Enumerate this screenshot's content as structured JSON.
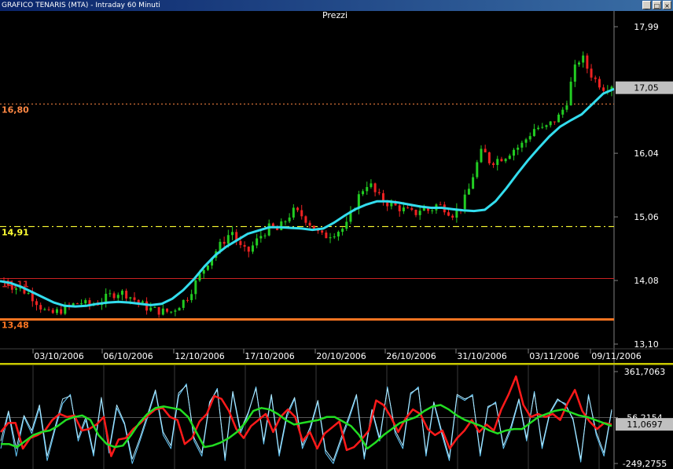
{
  "window": {
    "title": "GRAFICO TENARIS (MTA) - Intraday 60 Minuti",
    "buttons": [
      "_",
      "□",
      "×"
    ]
  },
  "colors": {
    "background": "#000000",
    "up_candle": "#22cc22",
    "down_candle": "#ee2222",
    "ma": "#33ddee",
    "resistance": "#ff8844",
    "dash_yellow": "#ffff33",
    "support_red": "#cc2222",
    "support_orange": "#ff7722",
    "separator": "#c8c800",
    "osc_red": "#ff1a1a",
    "osc_green": "#22dd22",
    "osc_blue": "#66ccff"
  },
  "chart_data": [
    {
      "type": "candlestick",
      "title": "Prezzi",
      "ylim": [
        13.1,
        17.99
      ],
      "y_ticks": [
        "17,99",
        "16,04",
        "15,06",
        "14,08",
        "13,10"
      ],
      "last_price_label": "17,05",
      "last_price": 17.05,
      "x_labels": [
        "03/10/2006",
        "06/10/2006",
        "12/10/2006",
        "17/10/2006",
        "20/10/2006",
        "26/10/2006",
        "31/10/2006",
        "03/11/2006",
        "09/11/2006"
      ],
      "levels": [
        {
          "label": "16,80",
          "value": 16.8,
          "style": "dotted",
          "color": "#ff8844"
        },
        {
          "label": "14,91",
          "value": 14.91,
          "style": "dashdot",
          "color": "#ffff33"
        },
        {
          "label": "14,11",
          "value": 14.11,
          "style": "solid",
          "color": "#cc2222"
        },
        {
          "label": "13,48",
          "value": 13.48,
          "style": "thick",
          "color": "#ff7722"
        }
      ],
      "close_path": [
        14.08,
        14.0,
        13.95,
        13.9,
        13.8,
        13.65,
        13.55,
        13.6,
        13.65,
        13.7,
        13.75,
        13.7,
        13.72,
        13.78,
        13.85,
        13.9,
        13.88,
        13.8,
        13.72,
        13.65,
        13.62,
        13.6,
        13.6,
        13.7,
        13.8,
        14.0,
        14.2,
        14.4,
        14.55,
        14.7,
        14.85,
        14.6,
        14.5,
        14.65,
        14.8,
        14.9,
        14.85,
        15.0,
        15.15,
        15.1,
        15.0,
        14.85,
        14.75,
        14.8,
        14.85,
        14.9,
        15.2,
        15.45,
        15.6,
        15.4,
        15.3,
        15.25,
        15.2,
        15.15,
        15.1,
        15.2,
        15.15,
        15.25,
        15.2,
        15.1,
        15.2,
        15.4,
        15.8,
        16.1,
        15.9,
        15.95,
        16.0,
        16.1,
        16.15,
        16.3,
        16.45,
        16.4,
        16.5,
        16.6,
        16.8,
        17.3,
        17.55,
        17.3,
        17.15,
        17.05,
        17.1
      ],
      "ma_path": [
        14.07,
        14.04,
        13.98,
        13.9,
        13.82,
        13.74,
        13.69,
        13.68,
        13.69,
        13.72,
        13.74,
        13.75,
        13.74,
        13.72,
        13.7,
        13.72,
        13.8,
        13.93,
        14.1,
        14.3,
        14.47,
        14.6,
        14.7,
        14.8,
        14.85,
        14.9,
        14.9,
        14.89,
        14.88,
        14.86,
        14.88,
        14.97,
        15.08,
        15.18,
        15.25,
        15.3,
        15.3,
        15.28,
        15.25,
        15.22,
        15.2,
        15.2,
        15.18,
        15.16,
        15.15,
        15.17,
        15.3,
        15.5,
        15.72,
        15.93,
        16.12,
        16.3,
        16.45,
        16.55,
        16.64,
        16.8,
        16.96,
        17.03
      ]
    },
    {
      "type": "line",
      "ylim": [
        -249.2755,
        361.7063
      ],
      "y_ticks": [
        "361,7063",
        "56,2154",
        "-249,2755"
      ],
      "current_value_label": "11,0697",
      "current_value": 11.0697,
      "series": [
        {
          "values": [
            -150,
            90,
            -200,
            60,
            -50,
            120,
            -230,
            -30,
            150,
            210,
            -100,
            40,
            -200,
            180,
            -180,
            120,
            10,
            -250,
            -100,
            60,
            230,
            -60,
            -150,
            200,
            280,
            -100,
            -200,
            150,
            250,
            -230,
            220,
            -50,
            80,
            260,
            -120,
            200,
            -200,
            60,
            180,
            -150,
            -30,
            160,
            -180,
            -250,
            -100,
            40,
            200,
            -220,
            100,
            -100,
            260,
            -50,
            -150,
            210,
            260,
            -200,
            150,
            -50,
            -230,
            200,
            170,
            210,
            -200,
            120,
            160,
            -150,
            -20,
            170,
            -100,
            230,
            -150,
            80,
            170,
            150,
            40,
            -240,
            210,
            -60,
            -200,
            100
          ]
        },
        {
          "values": [
            -100,
            100,
            -150,
            70,
            -30,
            140,
            -200,
            -10,
            180,
            200,
            -80,
            60,
            -180,
            190,
            -160,
            140,
            20,
            -220,
            -80,
            80,
            240,
            -40,
            -130,
            220,
            270,
            -80,
            -180,
            160,
            240,
            -210,
            230,
            -30,
            90,
            250,
            -100,
            210,
            -180,
            80,
            190,
            -130,
            -10,
            170,
            -160,
            -230,
            -80,
            60,
            210,
            -200,
            110,
            -80,
            250,
            -30,
            -130,
            220,
            250,
            -180,
            160,
            -30,
            -210,
            210,
            180,
            200,
            -180,
            130,
            150,
            -130,
            0,
            180,
            -80,
            220,
            -130,
            90,
            180,
            140,
            50,
            -220,
            200,
            -40,
            -180,
            110
          ]
        },
        {
          "values": [
            -40,
            20,
            20,
            -150,
            -80,
            -60,
            -30,
            40,
            80,
            60,
            70,
            -30,
            -20,
            10,
            60,
            -200,
            -90,
            -80,
            -20,
            20,
            70,
            110,
            120,
            60,
            40,
            -120,
            -80,
            30,
            80,
            200,
            180,
            100,
            -20,
            -80,
            0,
            40,
            80,
            -40,
            60,
            110,
            60,
            -100,
            -40,
            -150,
            -50,
            -10,
            30,
            -160,
            -140,
            -90,
            -30,
            170,
            140,
            60,
            -40,
            50,
            110,
            80,
            -20,
            -60,
            -30,
            -150,
            -80,
            -30,
            40,
            -40,
            10,
            -30,
            110,
            210,
            330,
            140,
            60,
            80,
            60,
            80,
            40,
            150,
            240,
            100,
            30,
            -20,
            20,
            10
          ]
        },
        {
          "values": [
            -120,
            -120,
            -140,
            -100,
            -60,
            -40,
            -30,
            0,
            40,
            60,
            70,
            40,
            -60,
            -120,
            -140,
            -130,
            -60,
            20,
            80,
            120,
            130,
            120,
            110,
            60,
            -40,
            -140,
            -130,
            -110,
            -80,
            -40,
            20,
            100,
            120,
            110,
            80,
            40,
            10,
            20,
            30,
            40,
            60,
            60,
            30,
            0,
            -60,
            -150,
            -110,
            -60,
            -20,
            20,
            40,
            60,
            100,
            130,
            140,
            110,
            70,
            40,
            20,
            0,
            -30,
            -50,
            -30,
            -20,
            -20,
            20,
            60,
            80,
            100,
            110,
            90,
            70,
            60,
            40,
            20,
            0
          ]
        }
      ]
    }
  ]
}
